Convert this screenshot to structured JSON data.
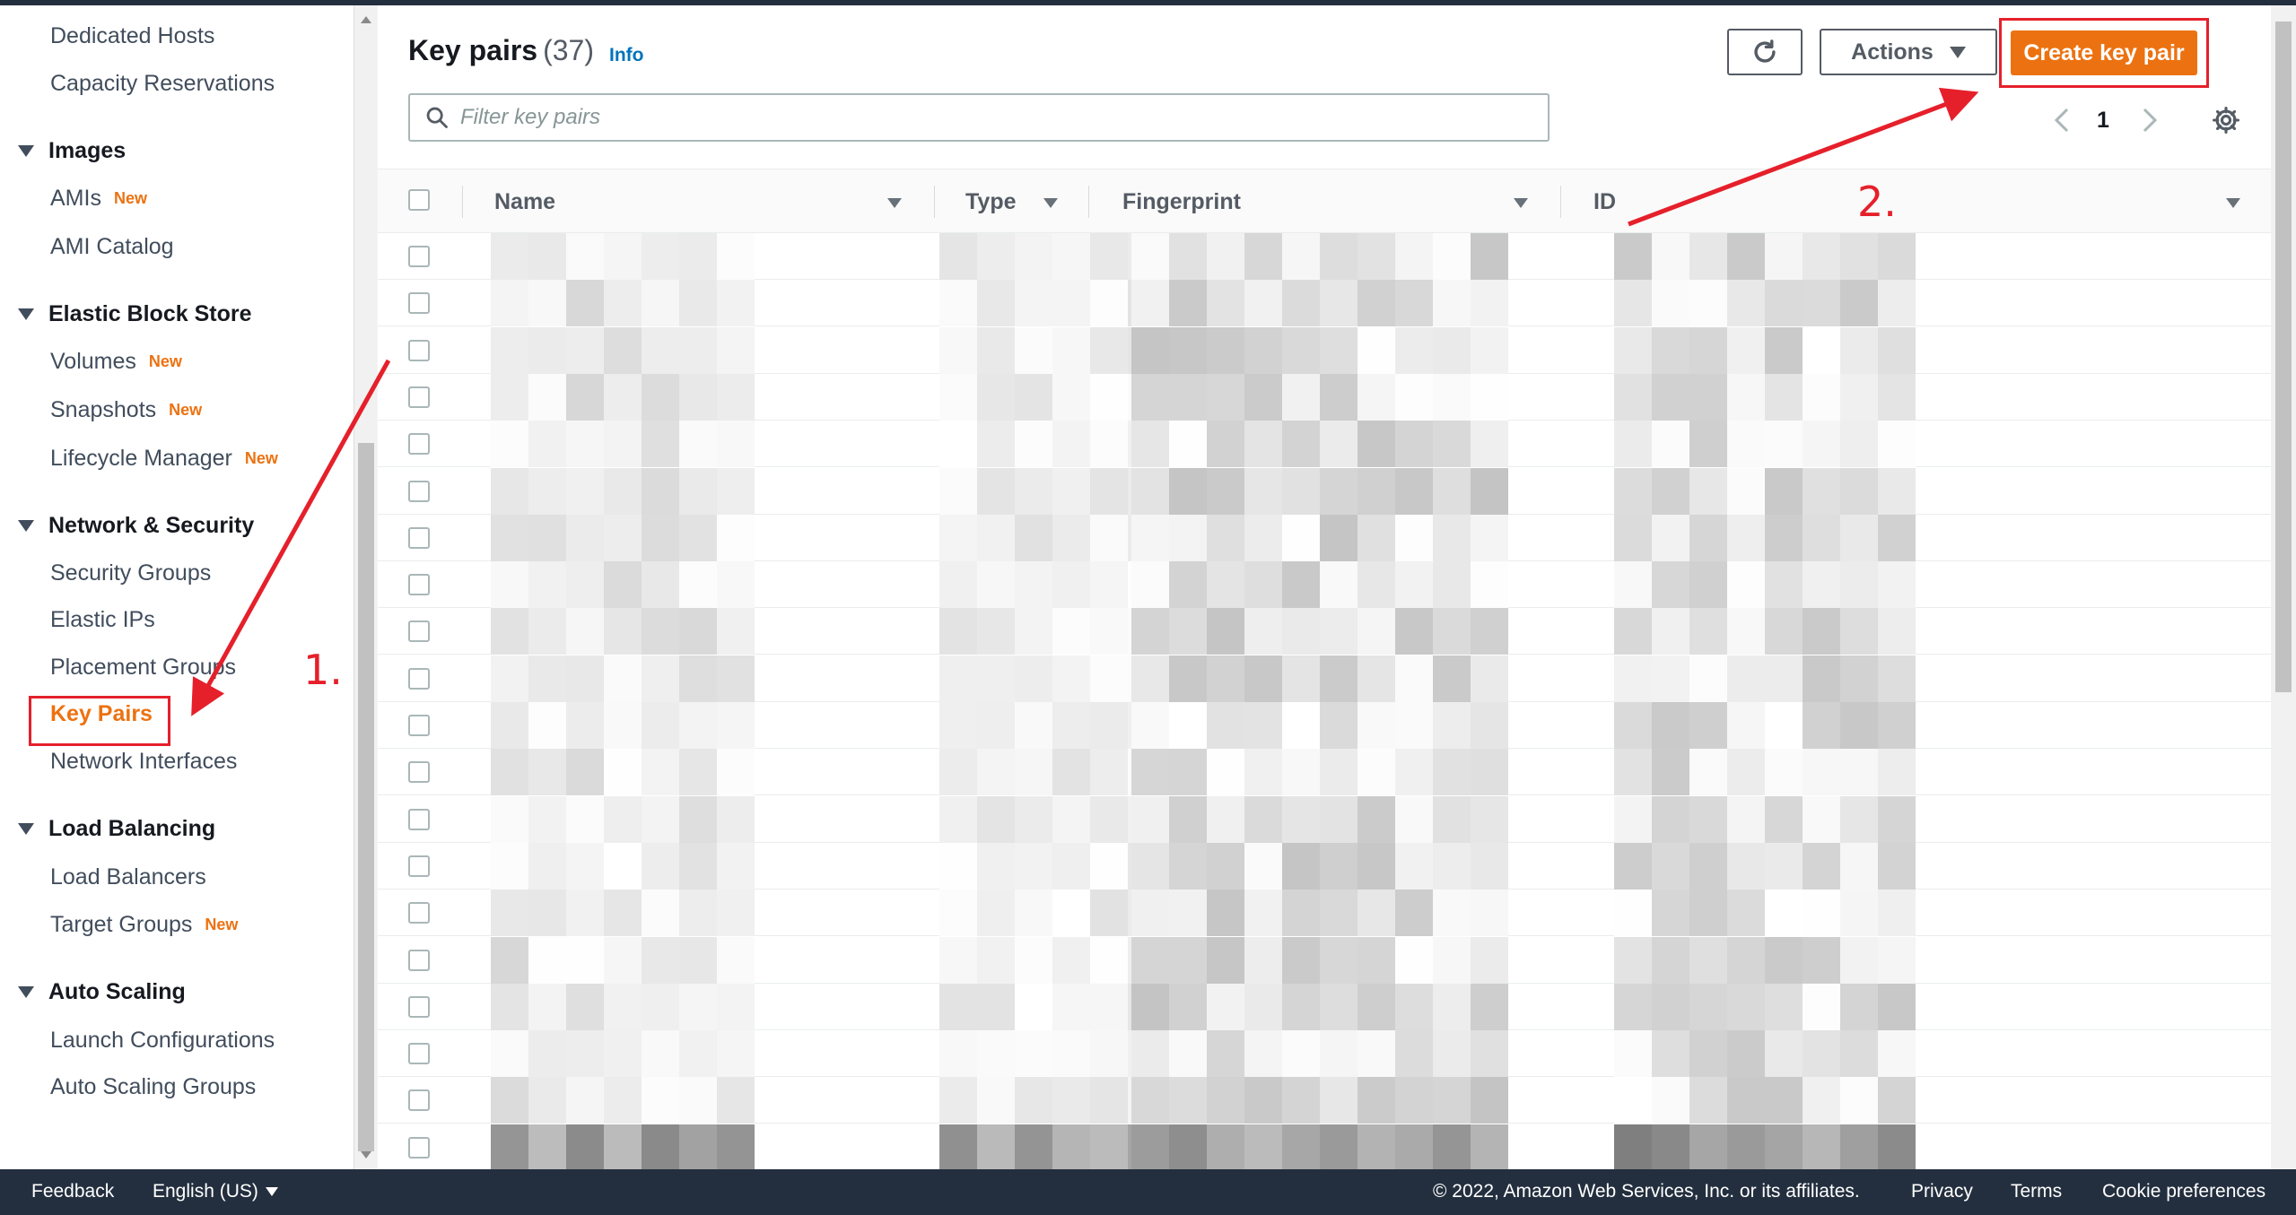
{
  "sidebar": {
    "items": [
      {
        "kind": "link",
        "label": "Dedicated Hosts",
        "badge": ""
      },
      {
        "kind": "link",
        "label": "Capacity Reservations",
        "badge": ""
      },
      {
        "kind": "section",
        "label": "Images"
      },
      {
        "kind": "link",
        "label": "AMIs",
        "badge": "New"
      },
      {
        "kind": "link",
        "label": "AMI Catalog",
        "badge": ""
      },
      {
        "kind": "section",
        "label": "Elastic Block Store"
      },
      {
        "kind": "link",
        "label": "Volumes",
        "badge": "New"
      },
      {
        "kind": "link",
        "label": "Snapshots",
        "badge": "New"
      },
      {
        "kind": "link",
        "label": "Lifecycle Manager",
        "badge": "New"
      },
      {
        "kind": "section",
        "label": "Network & Security"
      },
      {
        "kind": "link",
        "label": "Security Groups",
        "badge": ""
      },
      {
        "kind": "link",
        "label": "Elastic IPs",
        "badge": ""
      },
      {
        "kind": "link",
        "label": "Placement Groups",
        "badge": ""
      },
      {
        "kind": "link",
        "label": "Key Pairs",
        "badge": "",
        "active": true
      },
      {
        "kind": "link",
        "label": "Network Interfaces",
        "badge": ""
      },
      {
        "kind": "section",
        "label": "Load Balancing"
      },
      {
        "kind": "link",
        "label": "Load Balancers",
        "badge": ""
      },
      {
        "kind": "link",
        "label": "Target Groups",
        "badge": "New"
      },
      {
        "kind": "section",
        "label": "Auto Scaling"
      },
      {
        "kind": "link",
        "label": "Launch Configurations",
        "badge": ""
      },
      {
        "kind": "link",
        "label": "Auto Scaling Groups",
        "badge": ""
      }
    ]
  },
  "header": {
    "title": "Key pairs",
    "count": "(37)",
    "info": "Info",
    "actions_label": "Actions",
    "create_label": "Create key pair"
  },
  "search": {
    "placeholder": "Filter key pairs"
  },
  "pagination": {
    "page": "1"
  },
  "table": {
    "columns": [
      "Name",
      "Type",
      "Fingerprint",
      "ID"
    ],
    "visible_rows": 20
  },
  "annotations": {
    "step1": "1.",
    "step2": "2."
  },
  "footer": {
    "feedback": "Feedback",
    "language": "English (US)",
    "copyright": "© 2022, Amazon Web Services, Inc. or its affiliates.",
    "privacy": "Privacy",
    "terms": "Terms",
    "cookies": "Cookie preferences"
  },
  "colors": {
    "accent": "#ec7211",
    "annotation": "#e5202b",
    "footer_bg": "#232f3e",
    "link": "#0073bb"
  }
}
